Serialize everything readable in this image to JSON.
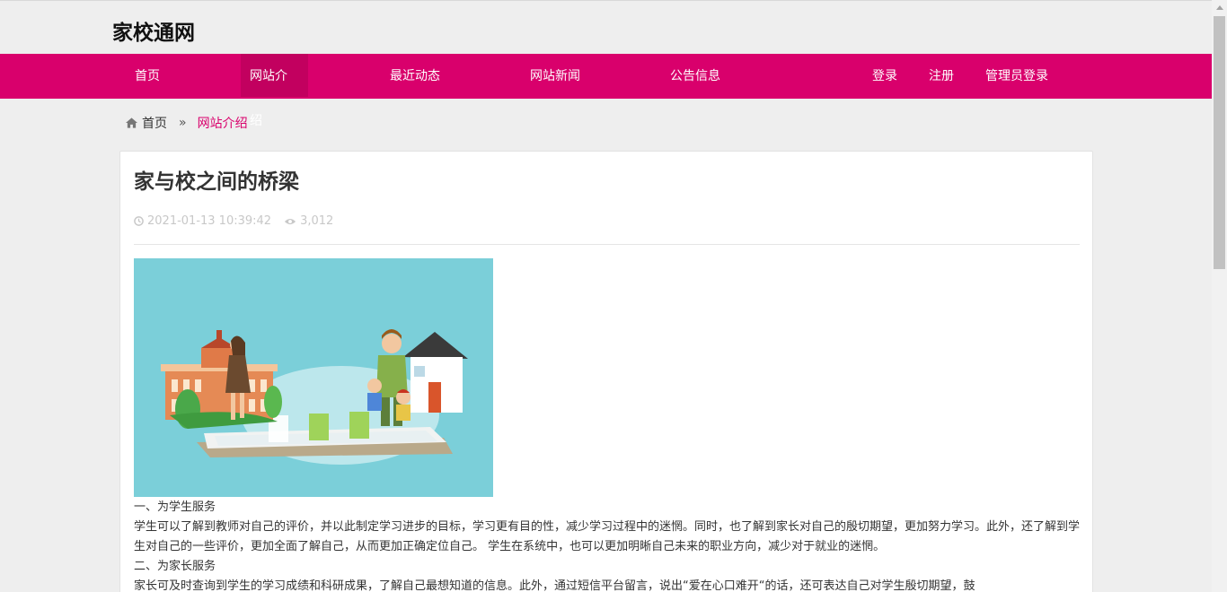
{
  "site": {
    "title": "家校通网"
  },
  "nav": {
    "items": [
      {
        "label": "首页"
      },
      {
        "label": "网站介绍"
      },
      {
        "label": "最近动态"
      },
      {
        "label": "网站新闻"
      },
      {
        "label": "公告信息"
      },
      {
        "label": "登录"
      },
      {
        "label": "注册"
      },
      {
        "label": "管理员登录"
      }
    ],
    "active": "网站介绍"
  },
  "breadcrumb": {
    "home": "首页",
    "separator": "»",
    "current": "网站介绍"
  },
  "article": {
    "title": "家与校之间的桥梁",
    "datetime": "2021-01-13 10:39:42",
    "views": "3,012",
    "paragraphs": [
      "一、为学生服务",
      "学生可以了解到教师对自己的评价，并以此制定学习进步的目标，学习更有目的性，减少学习过程中的迷惘。同时，也了解到家长对自己的殷切期望，更加努力学习。此外，还了解到学生对自己的一些评价，更加全面了解自己，从而更加正确定位自己。 学生在系统中，也可以更加明晰自己未来的职业方向，减少对于就业的迷惘。",
      "二、为家长服务",
      "家长可及时查询到学生的学习成绩和科研成果，了解自己最想知道的信息。此外，通过短信平台留言，说出“爱在心口难开“的话，还可表达自己对学生殷切期望，鼓"
    ]
  },
  "colors": {
    "brand": "#d9006c",
    "nav_active": "#c2005f",
    "meta": "#c8c8c8"
  },
  "icons": {
    "home": "home-icon",
    "clock": "clock-icon",
    "eye": "eye-icon"
  }
}
